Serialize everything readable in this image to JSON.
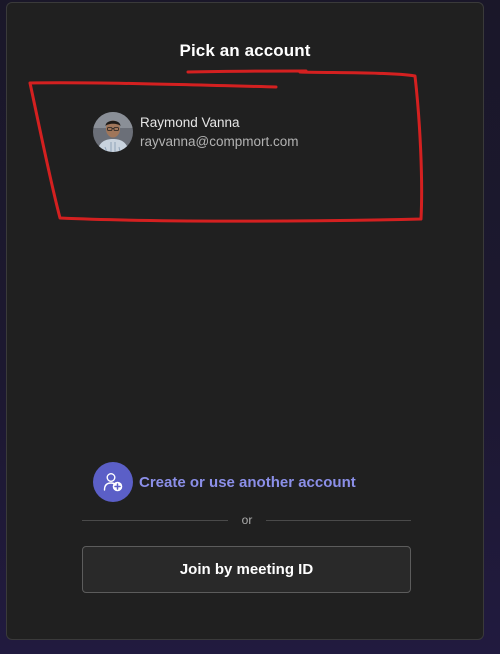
{
  "dialog": {
    "title": "Pick an account"
  },
  "account": {
    "name": "Raymond Vanna",
    "email": "rayvanna@compmort.com",
    "avatar_icon": "user-photo"
  },
  "create_account": {
    "label": "Create or use another account",
    "icon": "person-add-icon",
    "accent_color": "#5b5fc7",
    "text_color": "#8b8fe8"
  },
  "divider": {
    "text": "or"
  },
  "join": {
    "label": "Join by meeting ID"
  },
  "annotation": {
    "color": "#d42020"
  }
}
